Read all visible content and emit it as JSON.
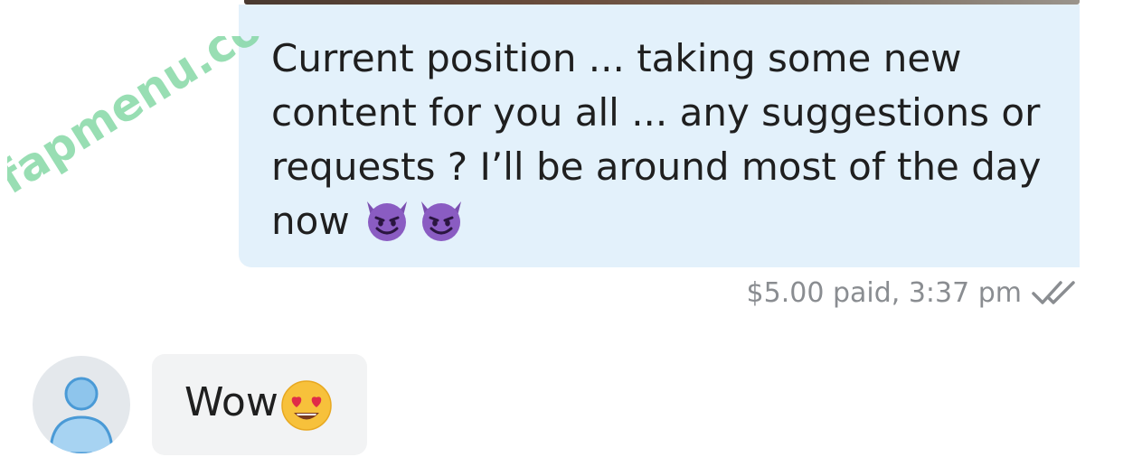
{
  "watermark": {
    "text": "fapmenu.com",
    "color": "#7ed6a0"
  },
  "sent_message": {
    "text": "Current position ... taking some new\ncontent for you all ... any suggestions or\nrequests ? I’ll be around most of the day\nnow",
    "emoji": [
      "smiling-imp-icon",
      "smiling-imp-icon"
    ],
    "bubble_color": "#e3f1fb",
    "meta": "$5.00 paid, 3:37 pm",
    "status_icon": "double-check-icon"
  },
  "received_message": {
    "text": "Wow",
    "emoji": "heart-eyes-icon",
    "bubble_color": "#f2f3f4",
    "avatar_icon": "default-user-avatar-icon"
  }
}
